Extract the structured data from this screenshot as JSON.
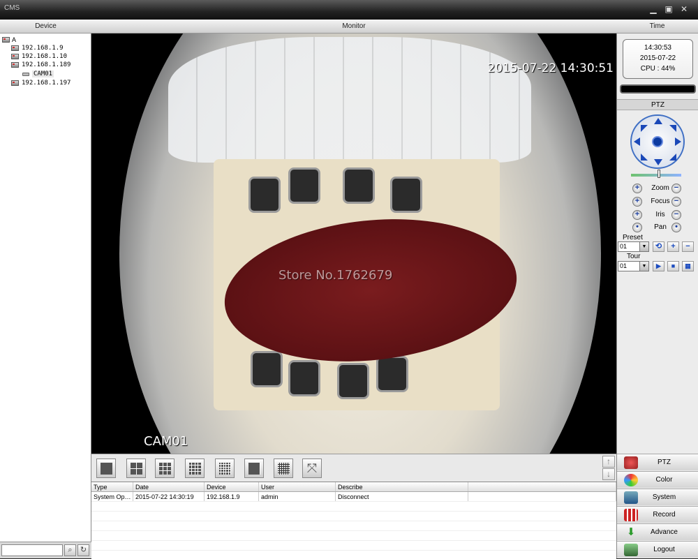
{
  "window": {
    "title": "CMS",
    "controls": [
      "minimize",
      "maximize",
      "close"
    ]
  },
  "headers": {
    "device": "Device",
    "monitor": "Monitor",
    "time": "Time"
  },
  "device_tree": {
    "root": "A",
    "items": [
      {
        "label": "192.168.1.9",
        "type": "device"
      },
      {
        "label": "192.168.1.10",
        "type": "device"
      },
      {
        "label": "192.168.1.189",
        "type": "device"
      },
      {
        "label": "CAM01",
        "type": "camera"
      },
      {
        "label": "192.168.1.197",
        "type": "device"
      }
    ]
  },
  "video": {
    "timestamp": "2015-07-22 14:30:51",
    "camera_label": "CAM01",
    "watermark": "Store No.1762679"
  },
  "clock": {
    "time": "14:30:53",
    "date": "2015-07-22",
    "cpu": "CPU : 44%"
  },
  "ptz": {
    "title": "PTZ",
    "controls": [
      {
        "label": "Zoom",
        "left": "+",
        "right": "−"
      },
      {
        "label": "Focus",
        "left": "+",
        "right": "−"
      },
      {
        "label": "Iris",
        "left": "+",
        "right": "−"
      },
      {
        "label": "Pan",
        "left": "•",
        "right": "•"
      }
    ],
    "preset_label": "Preset",
    "preset_value": "01",
    "tour_label": "Tour",
    "tour_value": "01"
  },
  "menu": [
    {
      "label": "PTZ",
      "icon": "ptz-icon",
      "color": "#c0392b"
    },
    {
      "label": "Color",
      "icon": "color-icon",
      "color": "#2e8b57"
    },
    {
      "label": "System",
      "icon": "system-icon",
      "color": "#2a6fb0"
    },
    {
      "label": "Record",
      "icon": "record-icon",
      "color": "#c0392b"
    },
    {
      "label": "Advance",
      "icon": "advance-icon",
      "color": "#3a9a3a"
    },
    {
      "label": "Logout",
      "icon": "logout-icon",
      "color": "#3a8a3a"
    }
  ],
  "log": {
    "columns": [
      "Type",
      "Date",
      "Device",
      "User",
      "Describe",
      ""
    ],
    "rows": [
      [
        "System Ope...",
        "2015-07-22 14:30:19",
        "192.168.1.9",
        "admin",
        "Disconnect",
        ""
      ]
    ]
  }
}
